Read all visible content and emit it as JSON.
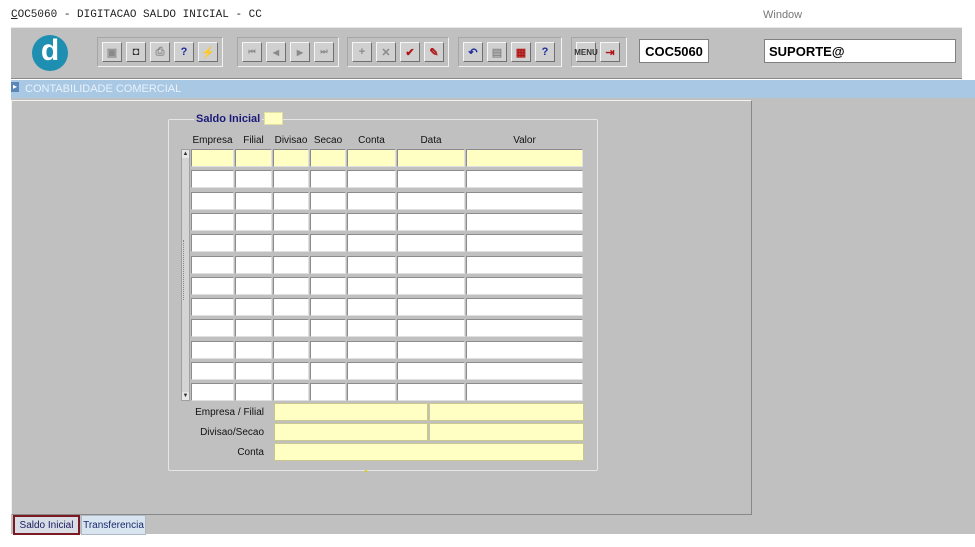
{
  "window": {
    "title_prefix": "C",
    "title_rest": "OC5060 - DIGITACAO SALDO INICIAL - CC",
    "menu_window": "Window"
  },
  "toolbar": {
    "logo_letter": "d",
    "form_code": "COC5060",
    "user": "SUPORTE@",
    "buttons": [
      {
        "name": "save-icon",
        "glyph": "▣"
      },
      {
        "name": "window-icon",
        "glyph": "◘"
      },
      {
        "name": "print-icon",
        "glyph": "⎙"
      },
      {
        "name": "query-icon",
        "glyph": "?"
      },
      {
        "name": "execute-query-icon",
        "glyph": "⚡"
      },
      {
        "name": "first-record-icon",
        "glyph": "⏮"
      },
      {
        "name": "previous-record-icon",
        "glyph": "◀"
      },
      {
        "name": "next-record-icon",
        "glyph": "▶"
      },
      {
        "name": "last-record-icon",
        "glyph": "⏭"
      },
      {
        "name": "insert-record-icon",
        "glyph": "+"
      },
      {
        "name": "delete-record-icon",
        "glyph": "✕"
      },
      {
        "name": "commit-icon",
        "glyph": "✔"
      },
      {
        "name": "edit-icon",
        "glyph": "✎"
      },
      {
        "name": "undo-icon",
        "glyph": "↶"
      },
      {
        "name": "clipboard-icon",
        "glyph": "▤"
      },
      {
        "name": "list-values-icon",
        "glyph": "▦"
      },
      {
        "name": "help-icon",
        "glyph": "?"
      },
      {
        "name": "menu-icon",
        "glyph": "MENU"
      },
      {
        "name": "exit-icon",
        "glyph": "⇥"
      }
    ]
  },
  "header": {
    "section_label": "CONTABILIDADE COMERCIAL"
  },
  "group": {
    "title": "Saldo Inicial",
    "columns": [
      "Empresa",
      "Filial",
      "Divisao",
      "Secao",
      "Conta",
      "Data",
      "Valor"
    ],
    "row_count": 12
  },
  "footer_fields": {
    "empresa_filial_label": "Empresa / Filial",
    "divisao_secao_label": "Divisao/Secao",
    "conta_label": "Conta"
  },
  "tabs": {
    "saldo_inicial": "Saldo Inicial",
    "transferencia": "Transferencia"
  }
}
